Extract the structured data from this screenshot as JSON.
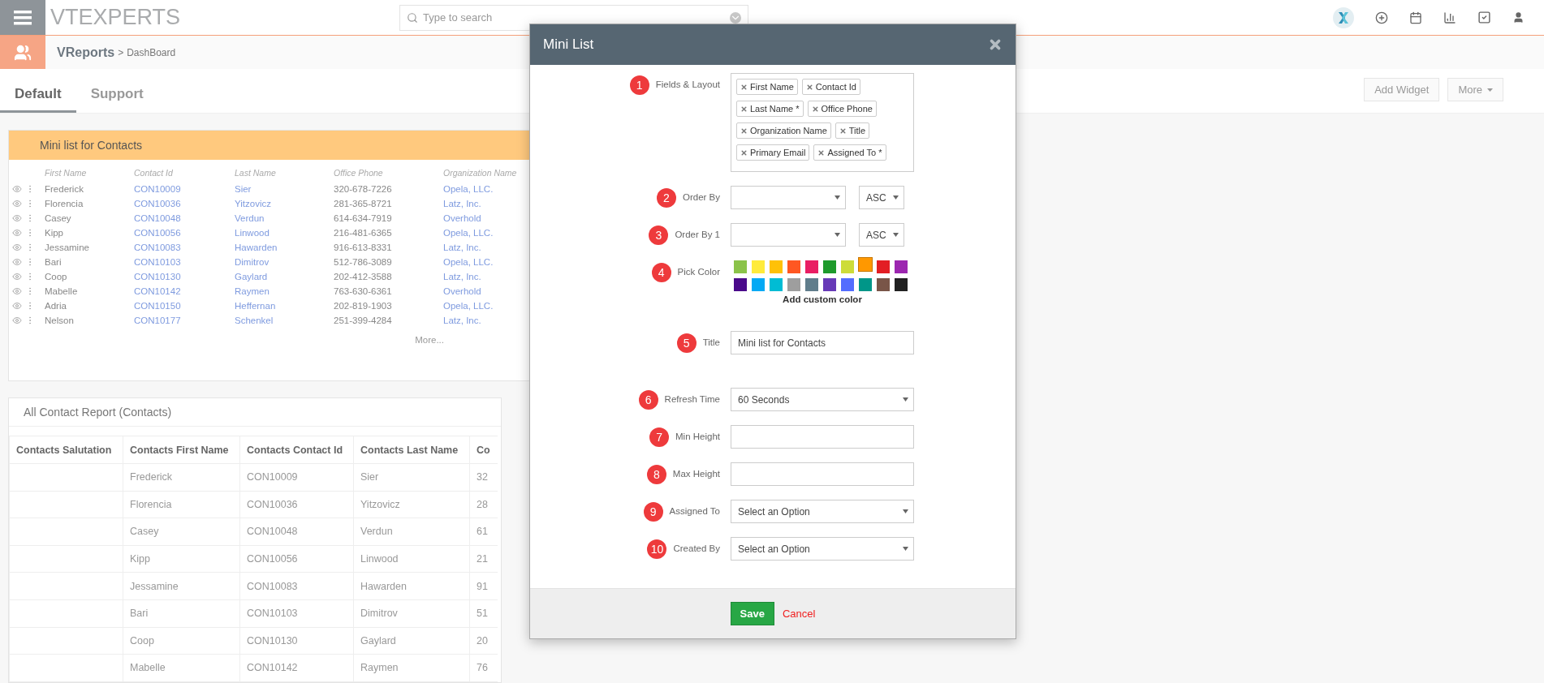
{
  "topbar": {
    "logo": "VTEXPERTS",
    "search": {
      "placeholder": "Type to search"
    }
  },
  "breadcrumb": {
    "app": "VReports",
    "separator": ">",
    "page": "DashBoard"
  },
  "tabs": [
    {
      "label": "Default",
      "selected": true
    },
    {
      "label": "Support",
      "selected": false
    }
  ],
  "actions": [
    {
      "label": "Add Widget",
      "kind": "button"
    },
    {
      "label": "More",
      "kind": "dropdown"
    }
  ],
  "mini_list": {
    "title": "Mini list for Contacts",
    "columns": [
      {
        "label": "First Name",
        "link": false
      },
      {
        "label": "Contact Id",
        "link": true
      },
      {
        "label": "Last Name",
        "link": true
      },
      {
        "label": "Office Phone",
        "link": false
      },
      {
        "label": "Organization Name",
        "link": true
      }
    ],
    "rows": [
      [
        "Frederick",
        "CON10009",
        "Sier",
        "320-678-7226",
        "Opela, LLC."
      ],
      [
        "Florencia",
        "CON10036",
        "Yitzovicz",
        "281-365-8721",
        "Latz, Inc."
      ],
      [
        "Casey",
        "CON10048",
        "Verdun",
        "614-634-7919",
        "Overhold"
      ],
      [
        "Kipp",
        "CON10056",
        "Linwood",
        "216-481-6365",
        "Opela, LLC."
      ],
      [
        "Jessamine",
        "CON10083",
        "Hawarden",
        "916-613-8331",
        "Latz, Inc."
      ],
      [
        "Bari",
        "CON10103",
        "Dimitrov",
        "512-786-3089",
        "Opela, LLC."
      ],
      [
        "Coop",
        "CON10130",
        "Gaylard",
        "202-412-3588",
        "Latz, Inc."
      ],
      [
        "Mabelle",
        "CON10142",
        "Raymen",
        "763-630-6361",
        "Overhold"
      ],
      [
        "Adria",
        "CON10150",
        "Heffernan",
        "202-819-1903",
        "Opela, LLC."
      ],
      [
        "Nelson",
        "CON10177",
        "Schenkel",
        "251-399-4284",
        "Latz, Inc."
      ]
    ],
    "more": "More..."
  },
  "report": {
    "title": "All Contact Report (Contacts)",
    "columns": [
      "Contacts Salutation",
      "Contacts First Name",
      "Contacts Contact Id",
      "Contacts Last Name",
      "Co"
    ],
    "rows": [
      [
        "",
        "Frederick",
        "CON10009",
        "Sier",
        "32"
      ],
      [
        "",
        "Florencia",
        "CON10036",
        "Yitzovicz",
        "28"
      ],
      [
        "",
        "Casey",
        "CON10048",
        "Verdun",
        "61"
      ],
      [
        "",
        "Kipp",
        "CON10056",
        "Linwood",
        "21"
      ],
      [
        "",
        "Jessamine",
        "CON10083",
        "Hawarden",
        "91"
      ],
      [
        "",
        "Bari",
        "CON10103",
        "Dimitrov",
        "51"
      ],
      [
        "",
        "Coop",
        "CON10130",
        "Gaylard",
        "20"
      ],
      [
        "",
        "Mabelle",
        "CON10142",
        "Raymen",
        "76"
      ]
    ]
  },
  "modal": {
    "title": "Mini List",
    "fields": [
      {
        "number": "1",
        "label": "Fields & Layout",
        "kind": "tags",
        "tags": [
          "First Name",
          "Contact Id",
          "Last Name *",
          "Office Phone",
          "Organization Name",
          "Title",
          "Primary Email",
          "Assigned To *"
        ]
      },
      {
        "number": "2",
        "label": "Order By",
        "kind": "order",
        "direction": "ASC"
      },
      {
        "number": "3",
        "label": "Order By 1",
        "kind": "order",
        "direction": "ASC"
      },
      {
        "number": "4",
        "label": "Pick Color",
        "kind": "colors",
        "custom": "Add custom color",
        "swatches": [
          {
            "color": "#8bc34a",
            "selected": false
          },
          {
            "color": "#ffeb3b",
            "selected": false
          },
          {
            "color": "#ffc107",
            "selected": false
          },
          {
            "color": "#ff5722",
            "selected": false
          },
          {
            "color": "#e91e63",
            "selected": false
          },
          {
            "color": "#1e9a2c",
            "selected": false
          },
          {
            "color": "#cddc39",
            "selected": false
          },
          {
            "color": "#ff9800",
            "selected": true
          },
          {
            "color": "#e31e24",
            "selected": false
          },
          {
            "color": "#9c27b0",
            "selected": false
          },
          {
            "color": "#4a0a8a",
            "selected": false
          },
          {
            "color": "#03a9f4",
            "selected": false
          },
          {
            "color": "#00bcd4",
            "selected": false
          },
          {
            "color": "#9e9e9e",
            "selected": false
          },
          {
            "color": "#607d8b",
            "selected": false
          },
          {
            "color": "#673ab7",
            "selected": false
          },
          {
            "color": "#536dfe",
            "selected": false
          },
          {
            "color": "#009688",
            "selected": false
          },
          {
            "color": "#795548",
            "selected": false
          },
          {
            "color": "#212121",
            "selected": false
          }
        ]
      },
      {
        "number": "5",
        "label": "Title",
        "kind": "text",
        "value": "Mini list for Contacts"
      },
      {
        "number": "6",
        "label": "Refresh Time",
        "kind": "select",
        "value": "60 Seconds"
      },
      {
        "number": "7",
        "label": "Min Height",
        "kind": "text"
      },
      {
        "number": "8",
        "label": "Max Height",
        "kind": "text"
      },
      {
        "number": "9",
        "label": "Assigned To",
        "kind": "select",
        "value": "Select an Option"
      },
      {
        "number": "10",
        "label": "Created By",
        "kind": "select",
        "value": "Select an Option"
      }
    ],
    "save": "Save",
    "cancel": "Cancel"
  }
}
